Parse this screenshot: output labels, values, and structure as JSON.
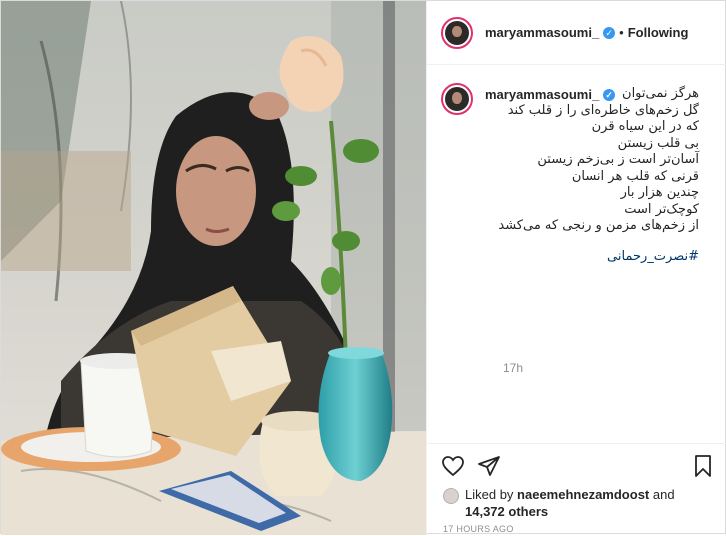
{
  "header": {
    "username": "maryammasoumi_",
    "separator": "•",
    "follow_label": "Following",
    "verified_glyph": "✓"
  },
  "caption": {
    "username": "maryammasoumi_",
    "lines": [
      "هرگز نمی‌توان",
      "گل زخم‌های خاطره‌ای را ز قلب کند",
      "که در این سیاه قرن",
      "بی قلب زیستن",
      "آسان‌تر است ز بی‌زخم زیستن",
      "قرنی که قلب هر انسان",
      "چندین هزار بار",
      "کوچک‌تر است",
      "از زخم‌های مزمن و رنجی که می‌کشد"
    ],
    "hashtag": "#نصرت_رحمانی",
    "time_ago": "17h"
  },
  "actions": {
    "like_icon": "heart-icon",
    "share_icon": "paper-plane-icon",
    "save_icon": "bookmark-icon"
  },
  "likes": {
    "prefix": "Liked by",
    "liker": "naeemehnezamdoost",
    "and": "and",
    "others": "14,372 others"
  },
  "date": "17 HOURS AGO",
  "colors": {
    "link": "#003569",
    "verified": "#3897f0",
    "story_ring": "#e1306c",
    "muted": "#8e8e8e"
  }
}
